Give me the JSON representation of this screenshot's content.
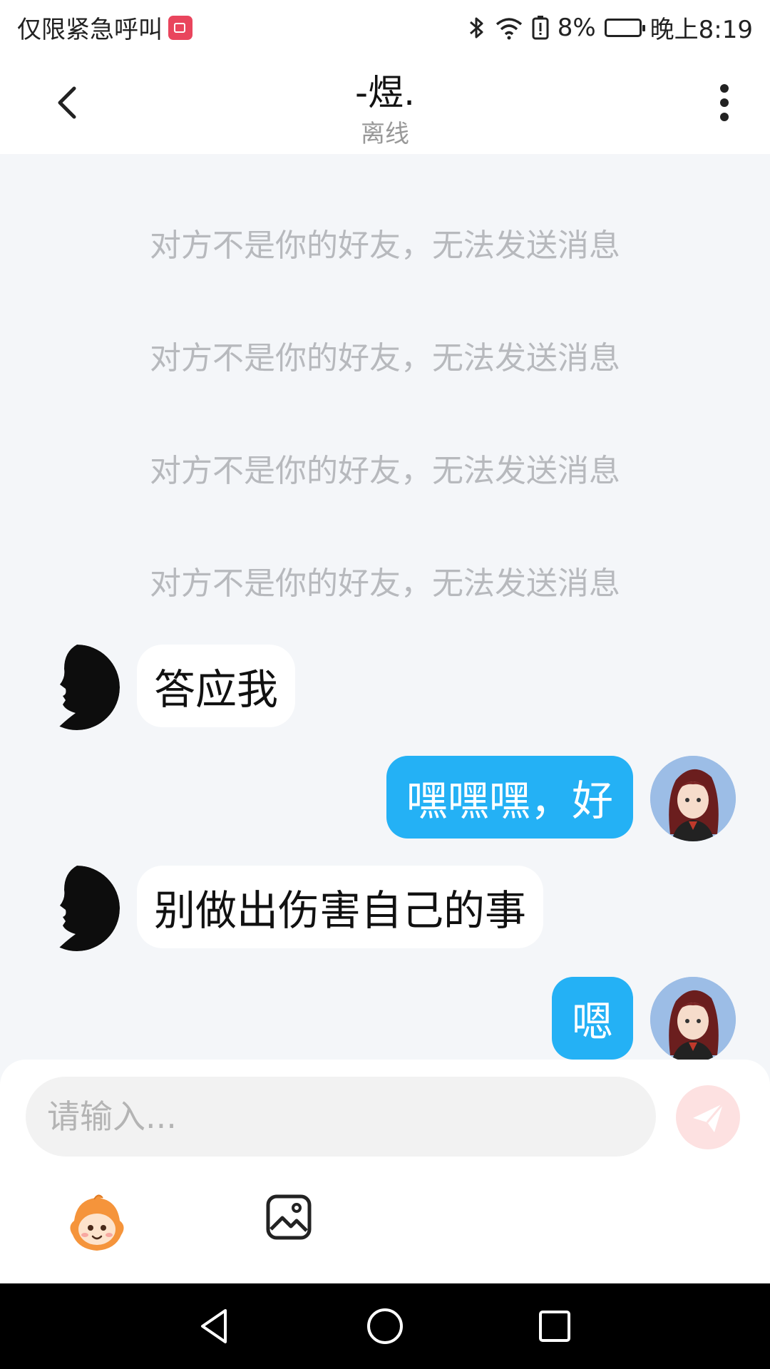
{
  "status_bar": {
    "left_text": "仅限紧急呼叫",
    "battery": "8%",
    "time": "晚上8:19"
  },
  "header": {
    "title": "-煜.",
    "subtitle": "离线"
  },
  "notices": [
    "对方不是你的好友，无法发送消息",
    "对方不是你的好友，无法发送消息",
    "对方不是你的好友，无法发送消息",
    "对方不是你的好友，无法发送消息"
  ],
  "messages": [
    {
      "side": "left",
      "text": "答应我"
    },
    {
      "side": "right",
      "text": "嘿嘿嘿，好"
    },
    {
      "side": "left",
      "text": "别做出伤害自己的事"
    },
    {
      "side": "right",
      "text": "嗯"
    }
  ],
  "input": {
    "placeholder": "请输入..."
  },
  "colors": {
    "accent": "#24b1f5",
    "chat_background": "#f4f6f9",
    "send_button": "#fde1e1"
  },
  "icons": {
    "back": "chevron-left-icon",
    "more": "more-vertical-icon",
    "send": "paper-plane-icon",
    "emoji": "emoji-mascot-icon",
    "image": "image-icon"
  }
}
